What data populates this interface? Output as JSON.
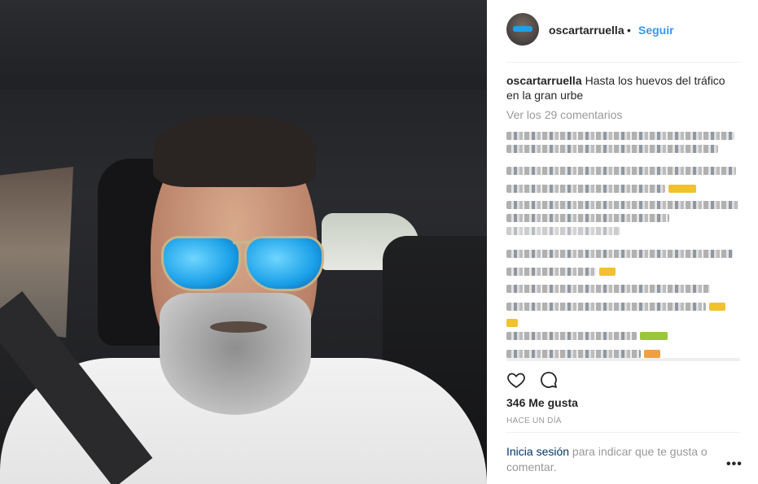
{
  "post": {
    "username": "oscartarruella",
    "separator": "•",
    "follow_label": "Seguir",
    "caption_text": "Hasta los huevos del tráfico en la gran urbe",
    "view_comments": "Ver los 29 comentarios",
    "likes": "346 Me gusta",
    "timestamp": "HACE UN DÍA",
    "login_link": "Inicia sesión",
    "login_text": " para indicar que te gusta o comentar.",
    "more_label": "•••"
  },
  "icons": {
    "like": "heart-icon",
    "comment": "comment-icon",
    "more": "more-options-icon"
  },
  "colors": {
    "link_blue": "#3897f0",
    "login_link": "#003569",
    "muted": "#999999",
    "text": "#262626"
  }
}
